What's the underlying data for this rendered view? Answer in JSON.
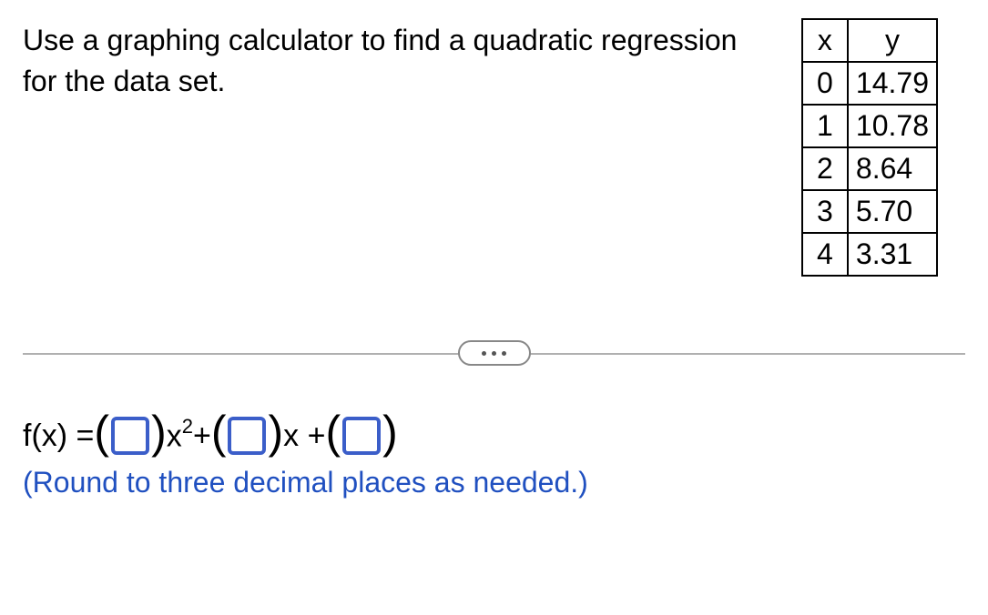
{
  "prompt": "Use a graphing calculator to find a quadratic regression for the data set.",
  "table": {
    "headers": {
      "x": "x",
      "y": "y"
    },
    "rows": [
      {
        "x": "0",
        "y": "14.79"
      },
      {
        "x": "1",
        "y": "10.78"
      },
      {
        "x": "2",
        "y": "8.64"
      },
      {
        "x": "3",
        "y": "5.70"
      },
      {
        "x": "4",
        "y": "3.31"
      }
    ]
  },
  "equation": {
    "lhs": "f(x) = ",
    "x2": "x",
    "sup": "2",
    "plus1": " + ",
    "x1": "x + ",
    "plus2": ""
  },
  "hint": "(Round to three decimal places as needed.)",
  "chart_data": {
    "type": "table",
    "columns": [
      "x",
      "y"
    ],
    "rows": [
      [
        0,
        14.79
      ],
      [
        1,
        10.78
      ],
      [
        2,
        8.64
      ],
      [
        3,
        5.7
      ],
      [
        4,
        3.31
      ]
    ]
  }
}
